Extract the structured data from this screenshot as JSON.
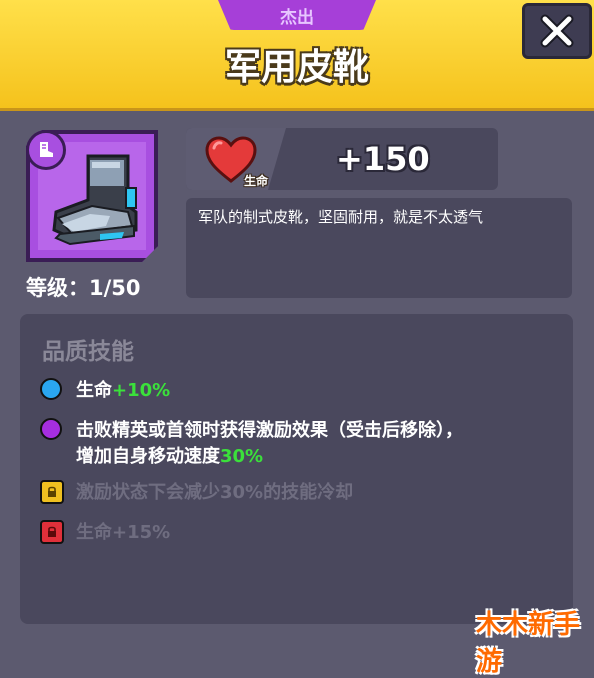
{
  "header": {
    "rarity_tab": "杰出",
    "title": "军用皮靴"
  },
  "item": {
    "icon": "military-boot-icon",
    "type_badge_icon": "boot-type-icon",
    "level_label": "等级：1/50"
  },
  "stat": {
    "icon": "heart-icon",
    "label": "生命",
    "value": "+150"
  },
  "description": "军队的制式皮靴，坚固耐用，就是不太透气",
  "skills": {
    "title": "品质技能",
    "items": [
      {
        "prefix": "生命",
        "highlight": "+10%",
        "suffix": "",
        "icon": "blue-quality-dot",
        "locked": false
      },
      {
        "prefix": "击败精英或首领时获得激励效果（受击后移除），",
        "line2_prefix": "增加自身移动速度",
        "highlight": "30%",
        "icon": "purple-quality-dot",
        "locked": false
      },
      {
        "text": "激励状态下会减少30%的技能冷却",
        "icon": "yellow-lock-icon",
        "locked": true
      },
      {
        "text": "生命+15%",
        "icon": "red-lock-icon",
        "locked": true
      }
    ]
  },
  "colors": {
    "header": "#f5c21c",
    "epic_purple": "#a84fe0",
    "panel": "#4a485d",
    "background": "#5c5a6f",
    "highlight_green": "#3be03b",
    "quality_blue": "#2aa6f0",
    "quality_purple": "#a62ee0",
    "lock_yellow": "#f0c020",
    "lock_red": "#e0303a"
  },
  "close_button_icon": "close-icon",
  "watermark": "木木新手游"
}
